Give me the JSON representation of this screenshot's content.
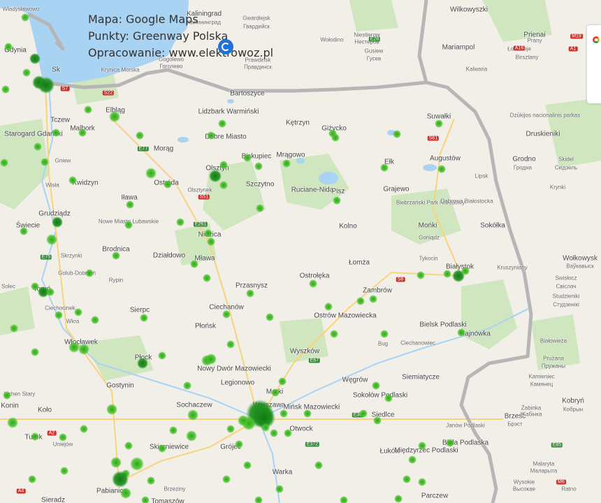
{
  "caption": {
    "line1": "Mapa: Google Maps",
    "line2": "Punkty: Greenway Polska",
    "line3": "Opracowanie: www.elektrowoz.pl"
  },
  "colors": {
    "sea": "#a9d3f2",
    "land": "#f2efe9",
    "forest": "#cfe6bf",
    "border": "#b6b6b6",
    "dot": "#3fbf1f",
    "dot_dark": "#1c8f1c"
  },
  "icons": [
    "elektrowoz-logo-icon",
    "google-maps-icon"
  ],
  "labels": [
    {
      "t": "Władysławowo",
      "c": "cy"
    },
    {
      "t": "Gdynia",
      "c": "big"
    },
    {
      "t": "Sk",
      "c": "big"
    },
    {
      "t": "Krynica Morska",
      "c": "cy"
    },
    {
      "t": "Tczew",
      "c": "big"
    },
    {
      "t": "Malbork",
      "c": "big"
    },
    {
      "t": "Elbląg",
      "c": "big"
    },
    {
      "t": "Starogard Gdański",
      "c": "big"
    },
    {
      "t": "Gniew",
      "c": "cy"
    },
    {
      "t": "Kwidzyn",
      "c": "big"
    },
    {
      "t": "Morąg",
      "c": "big"
    },
    {
      "t": "Grudziądz",
      "c": "big"
    },
    {
      "t": "Świecie",
      "c": "big"
    },
    {
      "t": "Iława",
      "c": "big"
    },
    {
      "t": "Ostróda",
      "c": "big"
    },
    {
      "t": "Olsztynek",
      "c": "cy"
    },
    {
      "t": "Nowe Miasto Lubawskie",
      "c": "cy"
    },
    {
      "t": "Brodnica",
      "c": "big"
    },
    {
      "t": "Działdowo",
      "c": "big"
    },
    {
      "t": "Golub-Dobrzyń",
      "c": "cy"
    },
    {
      "t": "Rypin",
      "c": "cy"
    },
    {
      "t": "Toruń",
      "c": "big"
    },
    {
      "t": "Ciechocinek",
      "c": "cy"
    },
    {
      "t": "Włocławek",
      "c": "big"
    },
    {
      "t": "Sierpc",
      "c": "big"
    },
    {
      "t": "Płock",
      "c": "big"
    },
    {
      "t": "Gostynin",
      "c": "big"
    },
    {
      "t": "Lichen Stary",
      "c": "cy"
    },
    {
      "t": "Konin",
      "c": "big"
    },
    {
      "t": "Koło",
      "c": "big"
    },
    {
      "t": "Turek",
      "c": "big"
    },
    {
      "t": "Uniejów",
      "c": "cy"
    },
    {
      "t": "Pabianice",
      "c": "big"
    },
    {
      "t": "Sieradz",
      "c": "big"
    },
    {
      "t": "Kaliningrad",
      "c": "big"
    },
    {
      "t": "Калининград",
      "c": "cy"
    },
    {
      "t": "Gwardiejsk",
      "c": "cy"
    },
    {
      "t": "Гвардейск",
      "c": "cy"
    },
    {
      "t": "Prawdinsk",
      "c": "cy"
    },
    {
      "t": "Правдинск",
      "c": "cy"
    },
    {
      "t": "Gusiew",
      "c": "cy"
    },
    {
      "t": "Гусев",
      "c": "cy"
    },
    {
      "t": "Niestierow",
      "c": "cy"
    },
    {
      "t": "Нестеров",
      "c": "cy"
    },
    {
      "t": "Wołodino",
      "c": "cy"
    },
    {
      "t": "Gogolewo",
      "c": "cy"
    },
    {
      "t": "Гоголево",
      "c": "cy"
    },
    {
      "t": "Bartoszyce",
      "c": "big"
    },
    {
      "t": "Lidzbark Warmiński",
      "c": "big"
    },
    {
      "t": "Dobre Miasto",
      "c": "big"
    },
    {
      "t": "Kętrzyn",
      "c": "big"
    },
    {
      "t": "Giżycko",
      "c": "big"
    },
    {
      "t": "Biskupiec",
      "c": "big"
    },
    {
      "t": "Mrągowo",
      "c": "big"
    },
    {
      "t": "Olsztyn",
      "c": "big"
    },
    {
      "t": "Ruciane-Nida",
      "c": "big"
    },
    {
      "t": "Pisz",
      "c": "big"
    },
    {
      "t": "Ełk",
      "c": "big"
    },
    {
      "t": "Grajewo",
      "c": "big"
    },
    {
      "t": "Szczytno",
      "c": "big"
    },
    {
      "t": "Nidzica",
      "c": "big"
    },
    {
      "t": "Kolno",
      "c": "big"
    },
    {
      "t": "Mława",
      "c": "big"
    },
    {
      "t": "Przasnysz",
      "c": "big"
    },
    {
      "t": "Ostrołęka",
      "c": "big"
    },
    {
      "t": "Łomża",
      "c": "big"
    },
    {
      "t": "Ciechanów",
      "c": "big"
    },
    {
      "t": "Zambrów",
      "c": "big"
    },
    {
      "t": "Ostrów Mazowiecka",
      "c": "big"
    },
    {
      "t": "Płońsk",
      "c": "big"
    },
    {
      "t": "Nowy Dwór Mazowiecki",
      "c": "big"
    },
    {
      "t": "Legionowo",
      "c": "big"
    },
    {
      "t": "Wyszków",
      "c": "big"
    },
    {
      "t": "Marki",
      "c": "big"
    },
    {
      "t": "Warszawa",
      "c": "big"
    },
    {
      "t": "Mińsk Mazowiecki",
      "c": "big"
    },
    {
      "t": "Otwock",
      "c": "big"
    },
    {
      "t": "Sochaczew",
      "c": "big"
    },
    {
      "t": "Skierniewice",
      "c": "big"
    },
    {
      "t": "Grójec",
      "c": "big"
    },
    {
      "t": "Warka",
      "c": "big"
    },
    {
      "t": "Tomaszów",
      "c": "big"
    },
    {
      "t": "Węgrów",
      "c": "big"
    },
    {
      "t": "Sokołów Podlaski",
      "c": "big"
    },
    {
      "t": "Siedlce",
      "c": "big"
    },
    {
      "t": "Łuków",
      "c": "big"
    },
    {
      "t": "Międzyrzec Podlaski",
      "c": "big"
    },
    {
      "t": "Siemiatycze",
      "c": "big"
    },
    {
      "t": "Biała Podlaska",
      "c": "big"
    },
    {
      "t": "Parczew",
      "c": "big"
    },
    {
      "t": "Janów Podlaski",
      "c": "cy"
    },
    {
      "t": "Ciechanowiec",
      "c": "cy"
    },
    {
      "t": "Bielsk Podlaski",
      "c": "big"
    },
    {
      "t": "Hajnówka",
      "c": "big"
    },
    {
      "t": "Białystok",
      "c": "big"
    },
    {
      "t": "Tykocin",
      "c": "cy"
    },
    {
      "t": "Mońki",
      "c": "big"
    },
    {
      "t": "Goniądz",
      "c": "cy"
    },
    {
      "t": "Biebrzański Park Narodowy",
      "c": "cy"
    },
    {
      "t": "Sokółka",
      "c": "big"
    },
    {
      "t": "Dąbrowa Białostocka",
      "c": "cy"
    },
    {
      "t": "Augustów",
      "c": "big"
    },
    {
      "t": "Suwałki",
      "c": "big"
    },
    {
      "t": "Lipsk",
      "c": "cy"
    },
    {
      "t": "Krynki",
      "c": "cy"
    },
    {
      "t": "Kruszyniany",
      "c": "cy"
    },
    {
      "t": "Białowieża",
      "c": "cy"
    },
    {
      "t": "Wilkowyszki",
      "c": "big"
    },
    {
      "t": "Mariampol",
      "c": "big"
    },
    {
      "t": "Kalwaria",
      "c": "cy"
    },
    {
      "t": "Łoździeje",
      "c": "cy"
    },
    {
      "t": "Prienai",
      "c": "big"
    },
    {
      "t": "Birsztany",
      "c": "cy"
    },
    {
      "t": "Druskieniki",
      "c": "big"
    },
    {
      "t": "Dzūkijos nacionalinis parkas",
      "c": "cy"
    },
    {
      "t": "Grodno",
      "c": "big"
    },
    {
      "t": "Гродна",
      "c": "cy"
    },
    {
      "t": "Skidel",
      "c": "cy"
    },
    {
      "t": "Скідзель",
      "c": "cy"
    },
    {
      "t": "Wołkowysk",
      "c": "big"
    },
    {
      "t": "Ваўкавыск",
      "c": "cy"
    },
    {
      "t": "Swisłocz",
      "c": "cy"
    },
    {
      "t": "Свіслач",
      "c": "cy"
    },
    {
      "t": "Studzieniki",
      "c": "cy"
    },
    {
      "t": "Студзенікі",
      "c": "cy"
    },
    {
      "t": "Prużana",
      "c": "cy"
    },
    {
      "t": "Пружаны",
      "c": "cy"
    },
    {
      "t": "Kamieniec",
      "c": "cy"
    },
    {
      "t": "Камянец",
      "c": "cy"
    },
    {
      "t": "Kobryń",
      "c": "big"
    },
    {
      "t": "Кобрын",
      "c": "cy"
    },
    {
      "t": "Brześć",
      "c": "big"
    },
    {
      "t": "Брэст",
      "c": "cy"
    },
    {
      "t": "Żabinka",
      "c": "cy"
    },
    {
      "t": "Жабінка",
      "c": "cy"
    },
    {
      "t": "Malaryta",
      "c": "cy"
    },
    {
      "t": "Маларыта",
      "c": "cy"
    },
    {
      "t": "Wysokie",
      "c": "cy"
    },
    {
      "t": "Высокае",
      "c": "cy"
    },
    {
      "t": "Ratno",
      "c": "cy"
    },
    {
      "t": "Prany",
      "c": "cy"
    },
    {
      "t": "Bug",
      "c": "cy"
    },
    {
      "t": "Wisła",
      "c": "cy"
    },
    {
      "t": "Wkra",
      "c": "cy"
    },
    {
      "t": "Skrzynki",
      "c": "cy"
    },
    {
      "t": "Solec",
      "c": "cy"
    },
    {
      "t": "Brzeziny",
      "c": "cy"
    }
  ],
  "roads": [
    "S7",
    "S22",
    "E28",
    "A1",
    "E77",
    "S51",
    "E67",
    "S61",
    "S8",
    "E30",
    "E372",
    "E85",
    "A16",
    "M6",
    "M19",
    "E261",
    "E75",
    "A2",
    "A4"
  ]
}
